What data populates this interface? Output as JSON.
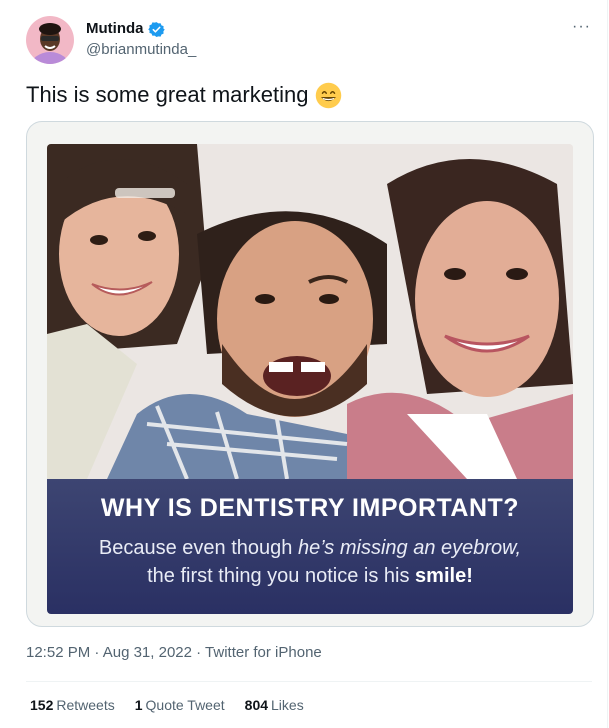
{
  "author": {
    "name": "Mutinda",
    "handle": "@brianmutinda_",
    "verified": true
  },
  "more_menu": {
    "label": "···"
  },
  "tweet": {
    "text": "This is some great marketing",
    "emoji": "grinning-face-with-smiling-eyes"
  },
  "media": {
    "banner_title": "WHY IS DENTISTRY IMPORTANT?",
    "line1_a": "Because even though ",
    "line1_b": "he’s missing an eyebrow,",
    "line2_a": "the first thing you notice is his ",
    "line2_b": "smile!"
  },
  "meta": {
    "time": "12:52 PM",
    "sep1": " · ",
    "date": "Aug 31, 2022",
    "sep2": " · ",
    "source": "Twitter for iPhone"
  },
  "stats": {
    "retweets_count": "152",
    "retweets_label": "Retweets",
    "quotes_count": "1",
    "quotes_label": "Quote Tweet",
    "likes_count": "804",
    "likes_label": "Likes"
  },
  "colors": {
    "verified_blue": "#1d9bf0",
    "secondary_text": "#536471",
    "banner_navy": "#343b6c"
  }
}
